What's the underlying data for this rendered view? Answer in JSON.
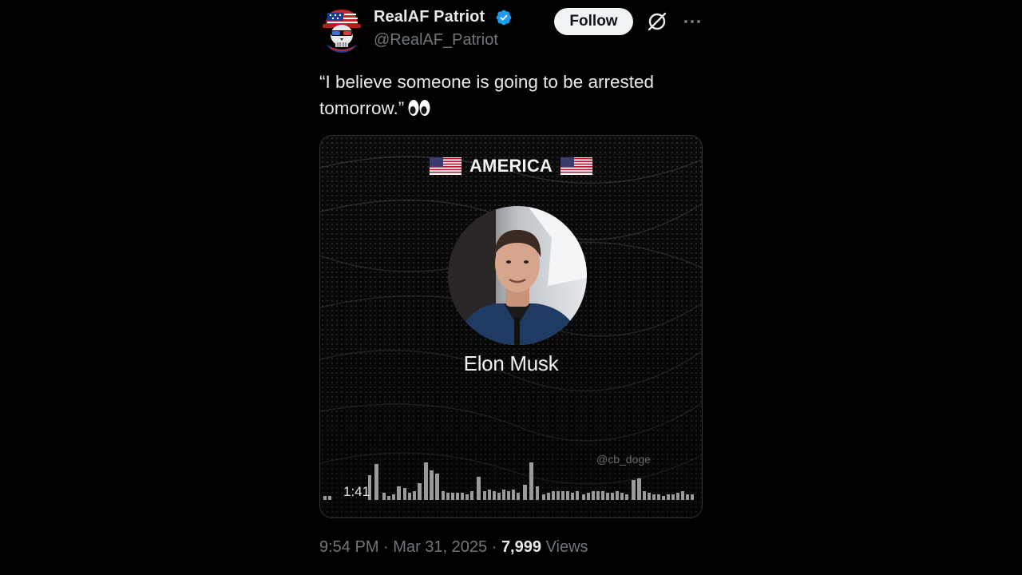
{
  "author": {
    "name": "RealAF Patriot",
    "handle": "@RealAF_Patriot",
    "verified": true
  },
  "header": {
    "follow_label": "Follow",
    "icons": [
      "grok-icon",
      "more-icon"
    ]
  },
  "tweet": {
    "text": "“I believe someone is going to be arrested tomorrow.”",
    "emoji": "eyes-icon"
  },
  "media": {
    "title": "AMERICA",
    "speaker": "Elon Musk",
    "watermark": "@cb_doge",
    "duration": "1:41"
  },
  "footer": {
    "time": "9:54 PM",
    "separator": "·",
    "date": "Mar 31, 2025",
    "views_count": "7,999",
    "views_label": "Views"
  },
  "colors": {
    "background": "#000000",
    "text_primary": "#e7e9ea",
    "text_secondary": "#71767b",
    "verified_blue": "#1d9bf0",
    "follow_bg": "#eff3f4"
  }
}
